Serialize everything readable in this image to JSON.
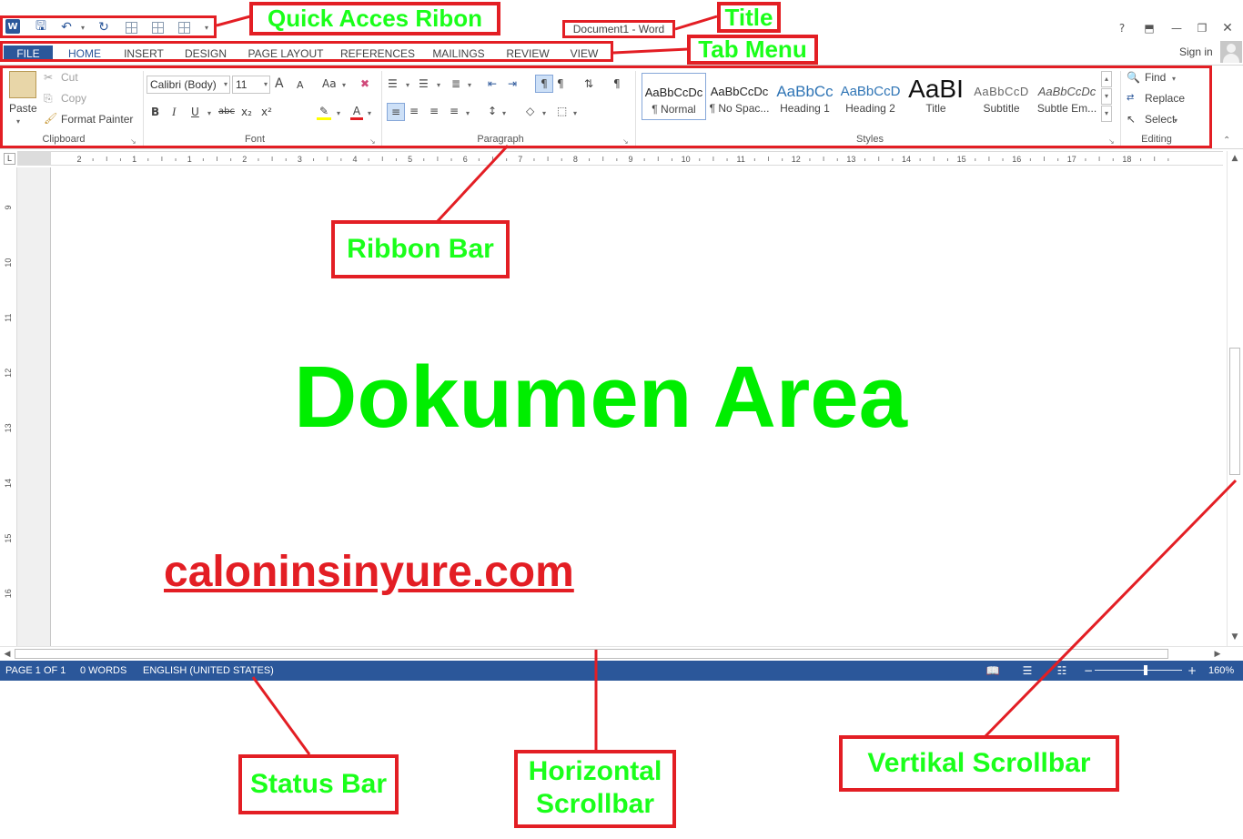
{
  "window": {
    "title": "Document1 - Word",
    "help": "?",
    "sign_in": "Sign in"
  },
  "quick_access": {
    "icons": [
      "word-logo",
      "save-icon",
      "undo-icon",
      "redo-icon",
      "table-icon",
      "table-icon",
      "table-icon",
      "customize-icon"
    ]
  },
  "tabs": [
    {
      "label": "FILE"
    },
    {
      "label": "HOME"
    },
    {
      "label": "INSERT"
    },
    {
      "label": "DESIGN"
    },
    {
      "label": "PAGE LAYOUT"
    },
    {
      "label": "REFERENCES"
    },
    {
      "label": "MAILINGS"
    },
    {
      "label": "REVIEW"
    },
    {
      "label": "VIEW"
    }
  ],
  "ribbon": {
    "clipboard": {
      "paste": "Paste",
      "cut": "Cut",
      "copy": "Copy",
      "format_painter": "Format Painter",
      "group_label": "Clipboard"
    },
    "font": {
      "font_name": "Calibri (Body)",
      "font_size": "11",
      "grow": "A",
      "shrink": "A",
      "change_case": "Aa",
      "bold": "B",
      "italic": "I",
      "underline": "U",
      "strikethrough": "abc",
      "subscript": "x₂",
      "superscript": "x²",
      "font_color": "A",
      "group_label": "Font"
    },
    "paragraph": {
      "group_label": "Paragraph"
    },
    "styles": {
      "items": [
        {
          "preview": "AaBbCcDc",
          "name": "¶ Normal"
        },
        {
          "preview": "AaBbCcDc",
          "name": "¶ No Spac..."
        },
        {
          "preview": "AaBbCc",
          "name": "Heading 1"
        },
        {
          "preview": "AaBbCcD",
          "name": "Heading 2"
        },
        {
          "preview": "AaBI",
          "name": "Title"
        },
        {
          "preview": "AaBbCcD",
          "name": "Subtitle"
        },
        {
          "preview": "AaBbCcDc",
          "name": "Subtle Em..."
        }
      ],
      "group_label": "Styles"
    },
    "editing": {
      "find": "Find",
      "replace": "Replace",
      "select": "Select",
      "group_label": "Editing"
    }
  },
  "ruler": {
    "corner": "L",
    "ticks": [
      "2",
      "1",
      "1",
      "2",
      "3",
      "4",
      "5",
      "6",
      "7",
      "8",
      "9",
      "10",
      "11",
      "12",
      "13",
      "14",
      "15",
      "16",
      "17",
      "18"
    ],
    "vticks": [
      "9",
      "10",
      "11",
      "12",
      "13",
      "14",
      "15",
      "16"
    ]
  },
  "document": {
    "heading": "Dokumen Area",
    "link": "caloninsinyure.com"
  },
  "statusbar": {
    "page": "PAGE 1 OF 1",
    "words": "0 WORDS",
    "language": "ENGLISH (UNITED STATES)",
    "zoom": "160%"
  },
  "annotations": {
    "quick_access": "Quick Acces Ribon",
    "title": "Title",
    "tab_menu": "Tab Menu",
    "ribbon_bar": "Ribbon Bar",
    "status_bar": "Status Bar",
    "horizontal_scrollbar_line1": "Horizontal",
    "horizontal_scrollbar_line2": "Scrollbar",
    "vertical_scrollbar": "Vertikal Scrollbar"
  },
  "colors": {
    "word_blue": "#2b579a",
    "annotation_red": "#e31e24",
    "annotation_green": "#1aff1a"
  }
}
